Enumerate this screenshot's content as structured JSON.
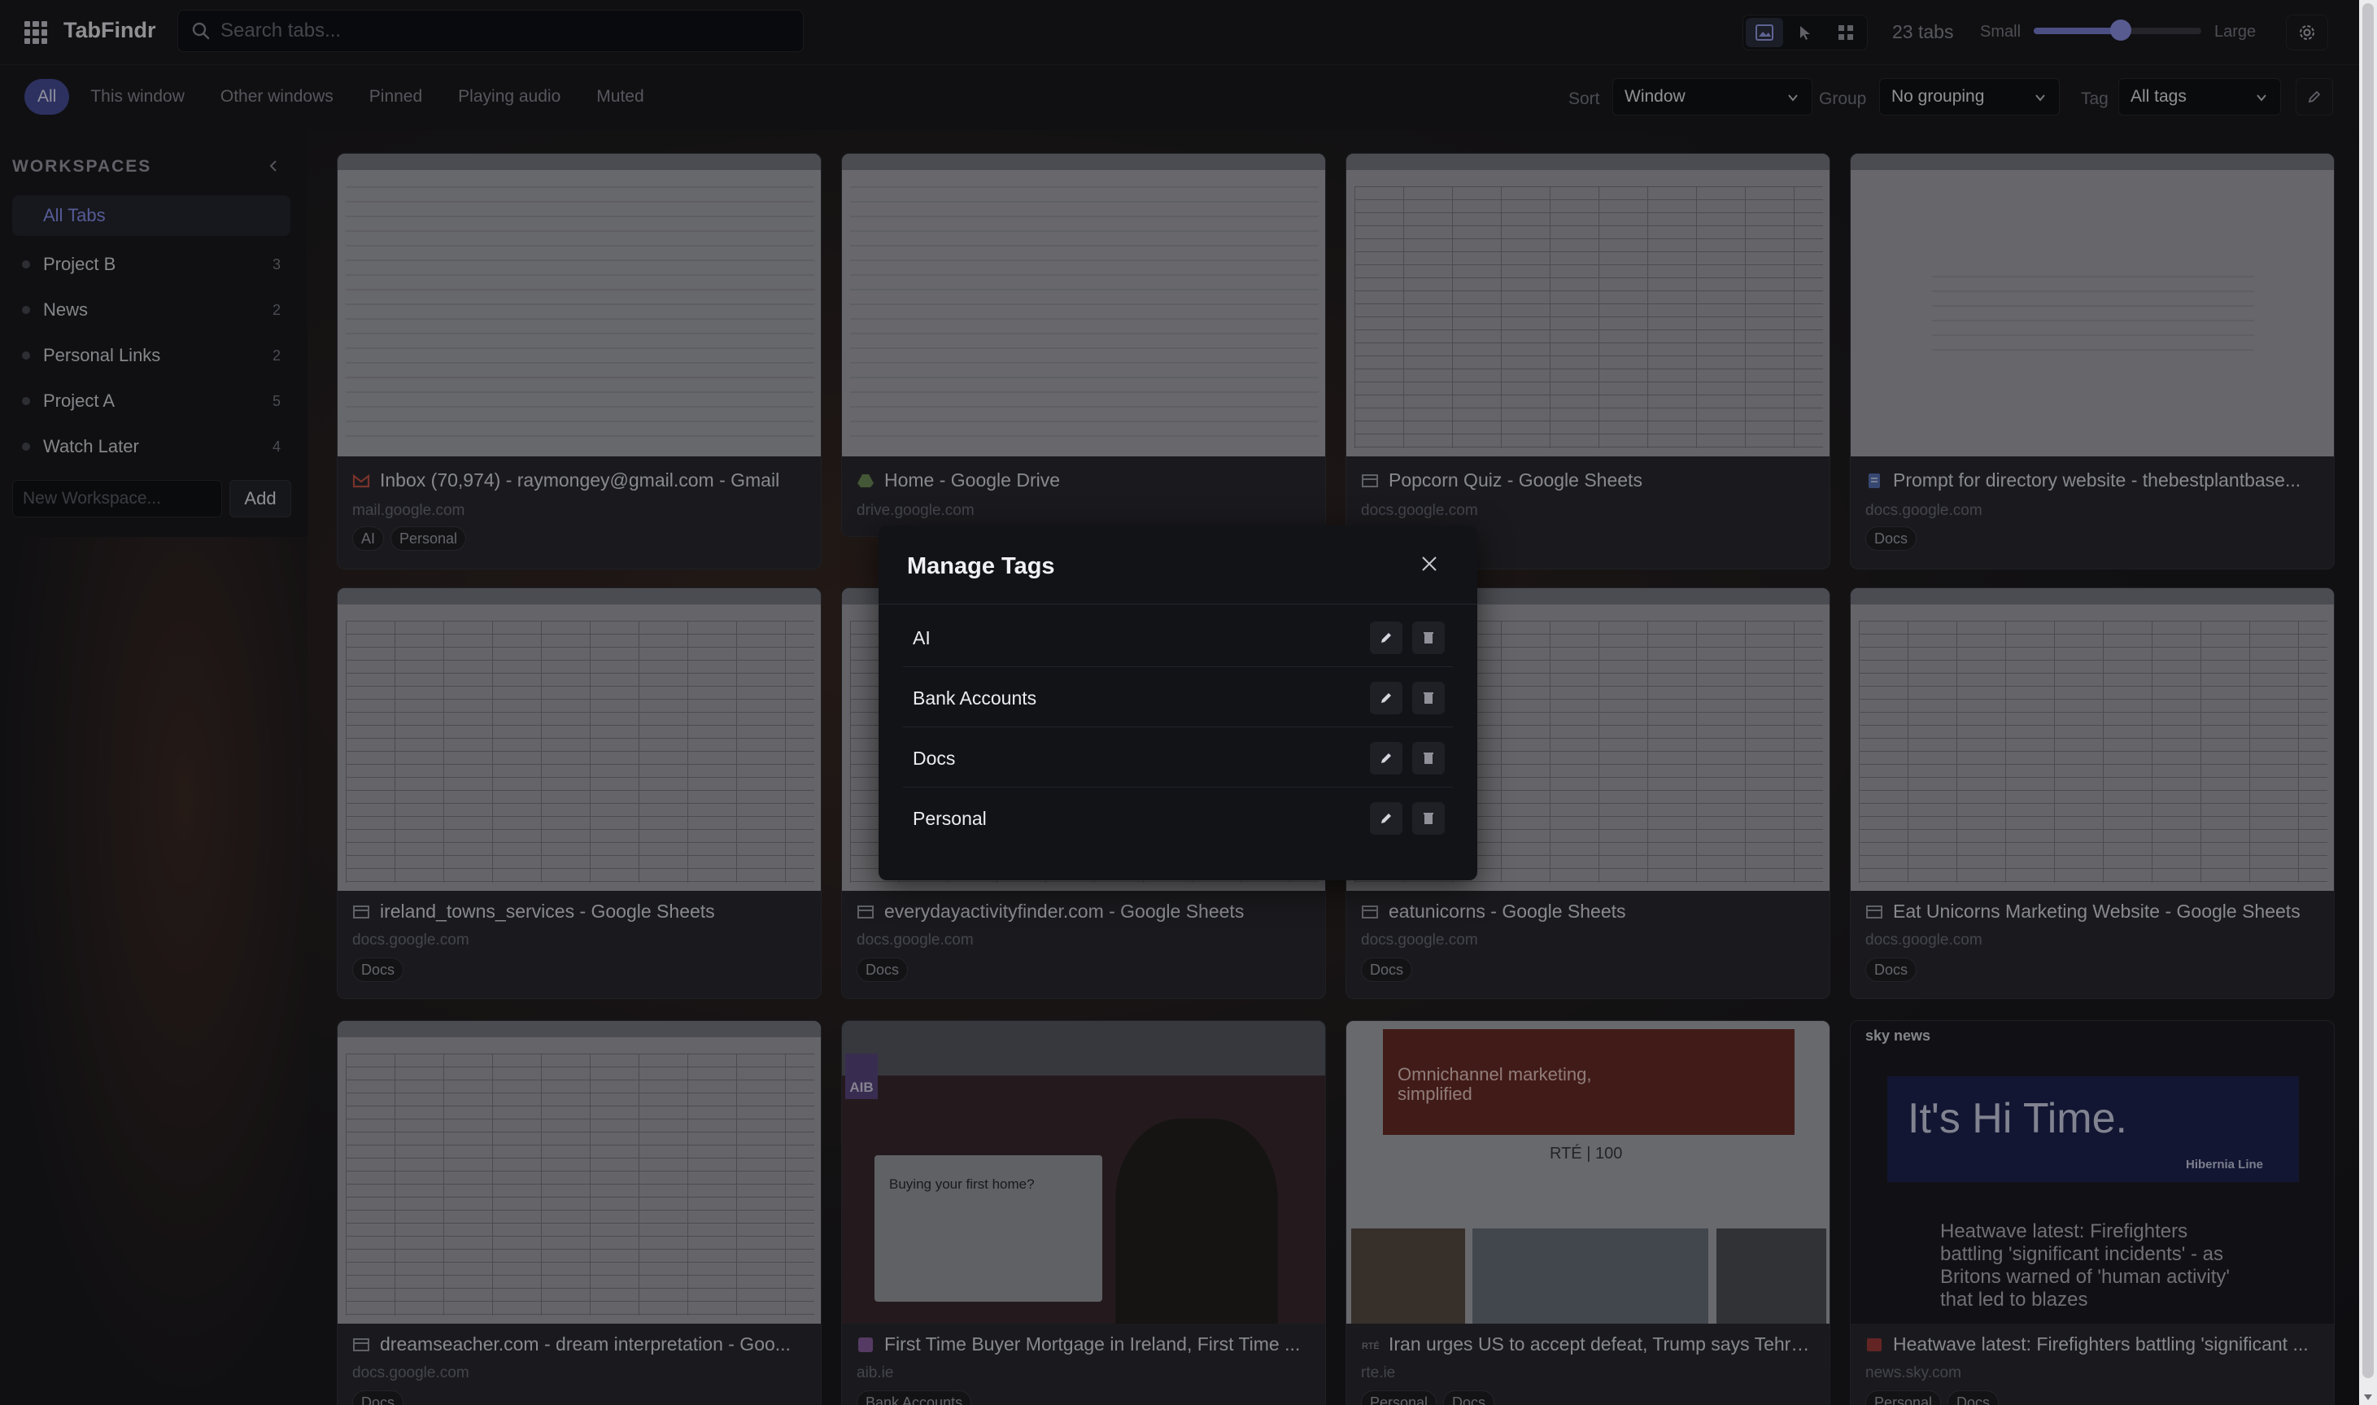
{
  "app": {
    "title": "TabFindr",
    "search_placeholder": "Search tabs..."
  },
  "header": {
    "tab_count": "23 tabs",
    "size_small": "Small",
    "size_large": "Large",
    "tab_size_level": 0.52,
    "icons": [
      "thumbnail-view-icon",
      "cursor-view-icon",
      "grid-view-icon",
      "settings-icon"
    ]
  },
  "filters": {
    "chips": [
      "All",
      "This window",
      "Other windows",
      "Pinned",
      "Playing audio",
      "Muted"
    ],
    "active_chip": "All",
    "sort_label": "Sort",
    "sort_value": "Window",
    "group_label": "Group",
    "group_value": "No grouping",
    "tag_label": "Tag",
    "tag_value": "All tags"
  },
  "sidebar": {
    "title": "WORKSPACES",
    "items": [
      {
        "label": "All Tabs",
        "count": ""
      },
      {
        "label": "Project B",
        "count": "3"
      },
      {
        "label": "News",
        "count": "2"
      },
      {
        "label": "Personal Links",
        "count": "2"
      },
      {
        "label": "Project A",
        "count": "5"
      },
      {
        "label": "Watch Later",
        "count": "4"
      }
    ],
    "new_placeholder": "New Workspace...",
    "add_label": "Add"
  },
  "cards": [
    {
      "title": "Inbox (70,974) - raymongey@gmail.com - Gmail",
      "url": "mail.google.com",
      "tags": [
        "AI",
        "Personal"
      ],
      "favicon": "gmail-icon"
    },
    {
      "title": "Home - Google Drive",
      "url": "drive.google.com",
      "tags": [],
      "favicon": "drive-icon"
    },
    {
      "title": "Popcorn Quiz - Google Sheets",
      "url": "docs.google.com",
      "tags": [],
      "favicon": "sheets-icon"
    },
    {
      "title": "Prompt for directory website - thebestplantbase...",
      "url": "docs.google.com",
      "tags": [
        "Docs"
      ],
      "favicon": "docs-icon"
    },
    {
      "title": "ireland_towns_services - Google Sheets",
      "url": "docs.google.com",
      "tags": [
        "Docs"
      ],
      "favicon": "sheets-icon"
    },
    {
      "title": "everydayactivityfinder.com - Google Sheets",
      "url": "docs.google.com",
      "tags": [
        "Docs"
      ],
      "favicon": "sheets-icon"
    },
    {
      "title": "eatunicorns - Google Sheets",
      "url": "docs.google.com",
      "tags": [
        "Docs"
      ],
      "favicon": "sheets-icon"
    },
    {
      "title": "Eat Unicorns Marketing Website - Google Sheets",
      "url": "docs.google.com",
      "tags": [
        "Docs"
      ],
      "favicon": "sheets-icon"
    },
    {
      "title": "dreamseacher.com - dream interpretation - Goo...",
      "url": "docs.google.com",
      "tags": [
        "Docs"
      ],
      "favicon": "sheets-icon"
    },
    {
      "title": "First Time Buyer Mortgage in Ireland, First Time ...",
      "url": "aib.ie",
      "tags": [
        "Bank Accounts"
      ],
      "favicon": "aib-icon"
    },
    {
      "title": "Iran urges US to accept defeat, Trump says Tehra...",
      "url": "rte.ie",
      "tags": [
        "Personal",
        "Docs"
      ],
      "favicon": "rte-icon"
    },
    {
      "title": "Heatwave latest: Firefighters battling 'significant ...",
      "url": "news.sky.com",
      "tags": [
        "Personal",
        "Docs"
      ],
      "favicon": "sky-icon"
    }
  ],
  "thumb_text": {
    "aib_logo": "AIB",
    "aib_heading": "Buying your first home?",
    "rte_banner": "Omnichannel marketing, simplified",
    "rte_logo": "RTÉ | 100",
    "sky_logo": "sky news",
    "sky_hi": "It's Hi Time.",
    "sky_sponsor": "Hibernia Line",
    "sky_headline": "Heatwave latest: Firefighters battling 'significant incidents' - as Britons warned of 'human activity' that led to blazes"
  },
  "modal": {
    "title": "Manage Tags",
    "tags": [
      "AI",
      "Bank Accounts",
      "Docs",
      "Personal"
    ]
  }
}
